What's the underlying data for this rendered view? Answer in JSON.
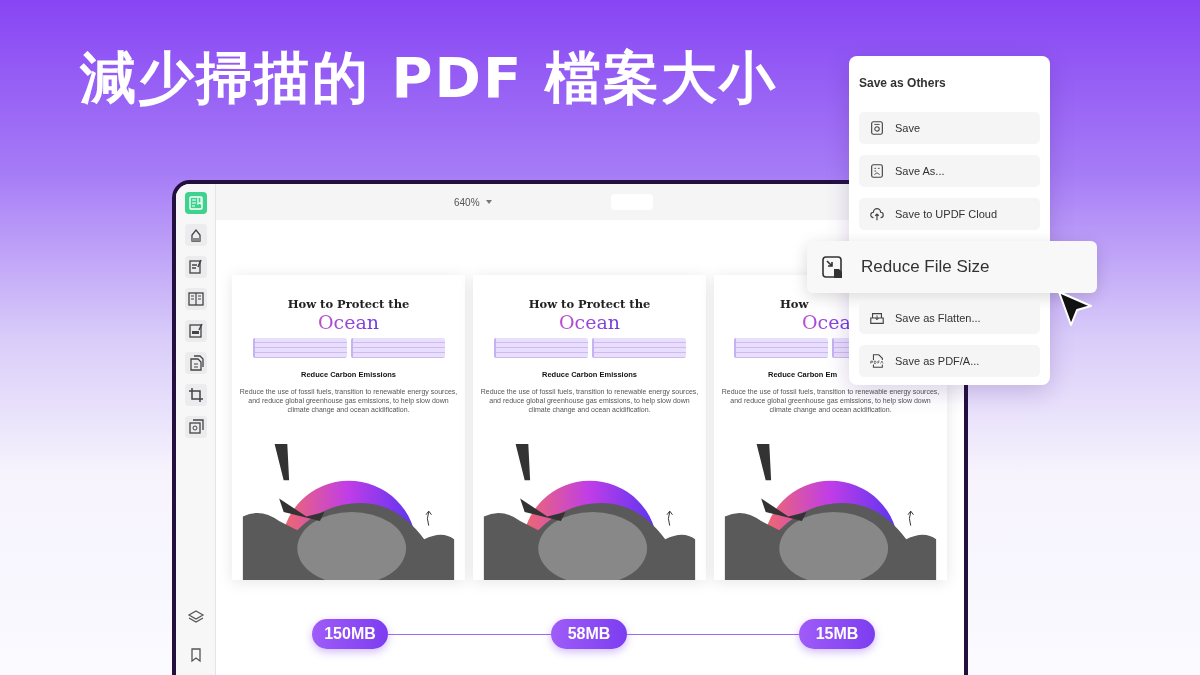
{
  "headline": "減少掃描的 PDF 檔案大小",
  "sidebar": {
    "tools": [
      {
        "kind": "reader",
        "selected": true
      },
      {
        "kind": "comment",
        "selected": false
      },
      {
        "kind": "edit",
        "selected": false
      },
      {
        "kind": "columns",
        "selected": false
      },
      {
        "kind": "form",
        "selected": false
      },
      {
        "kind": "pages",
        "selected": false
      },
      {
        "kind": "crop",
        "selected": false
      },
      {
        "kind": "combine",
        "selected": false
      }
    ],
    "bottom": [
      {
        "kind": "layers"
      },
      {
        "kind": "bookmark"
      }
    ]
  },
  "toolbar": {
    "zoom": "640%"
  },
  "pages": [
    {
      "title": "How to Protect the",
      "accent": "Ocean",
      "heading": "Reduce Carbon Emissions",
      "body": "Reduce the use of fossil fuels, transition to renewable energy sources, and reduce global greenhouse gas emissions, to help slow down climate change and ocean acidification."
    },
    {
      "title": "How to Protect the",
      "accent": "Ocean",
      "heading": "Reduce Carbon Emissions",
      "body": "Reduce the use of fossil fuels, transition to renewable energy sources, and reduce global greenhouse gas emissions, to help slow down climate change and ocean acidification."
    },
    {
      "title": "How",
      "accent": "Ocea",
      "heading": "Reduce Carbon Em",
      "body": "Reduce the use of fossil fuels, transition to renewable energy sources, and reduce global greenhouse gas emissions, to help slow down climate change and ocean acidification."
    }
  ],
  "sizes": [
    "150MB",
    "58MB",
    "15MB"
  ],
  "menu": {
    "title": "Save as Others",
    "items": [
      {
        "kind": "save",
        "label": "Save",
        "selected": false
      },
      {
        "kind": "save-as",
        "label": "Save As...",
        "selected": false
      },
      {
        "kind": "cloud",
        "label": "Save to UPDF Cloud",
        "selected": false
      },
      {
        "kind": "reduce",
        "label": "Reduce File Size",
        "selected": true
      },
      {
        "kind": "flatten",
        "label": "Save as Flatten...",
        "selected": false
      },
      {
        "kind": "pdfa",
        "label": "Save as PDF/A...",
        "selected": false
      }
    ]
  }
}
